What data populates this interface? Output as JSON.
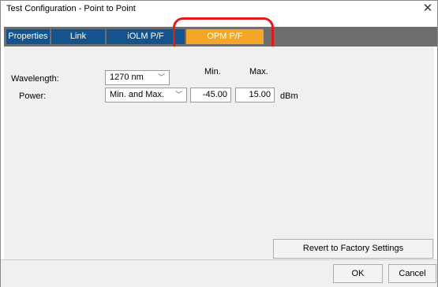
{
  "window": {
    "title": "Test Configuration - Point to Point"
  },
  "tabs": [
    {
      "label": "Properties",
      "active": false
    },
    {
      "label": "Link Definition",
      "active": false
    },
    {
      "label": "iOLM P/F Thresholds",
      "active": false
    },
    {
      "label": "OPM P/F Thresholds",
      "active": true
    }
  ],
  "columns": {
    "min": "Min.",
    "max": "Max."
  },
  "wavelength": {
    "label": "Wavelength:",
    "value": "1270 nm"
  },
  "power": {
    "label": "Power:",
    "mode": "Min. and Max.",
    "min": "-45.00",
    "max": "15.00",
    "unit": "dBm"
  },
  "buttons": {
    "revert": "Revert to Factory Settings",
    "ok": "OK",
    "cancel": "Cancel"
  },
  "icons": {
    "close": "close-icon",
    "dropdown": "chevron-down-icon"
  },
  "colors": {
    "tab_bg": "#15538e",
    "tab_active": "#f6a626",
    "highlight": "#e01b1b",
    "tabstrip": "#6e6e6e"
  }
}
